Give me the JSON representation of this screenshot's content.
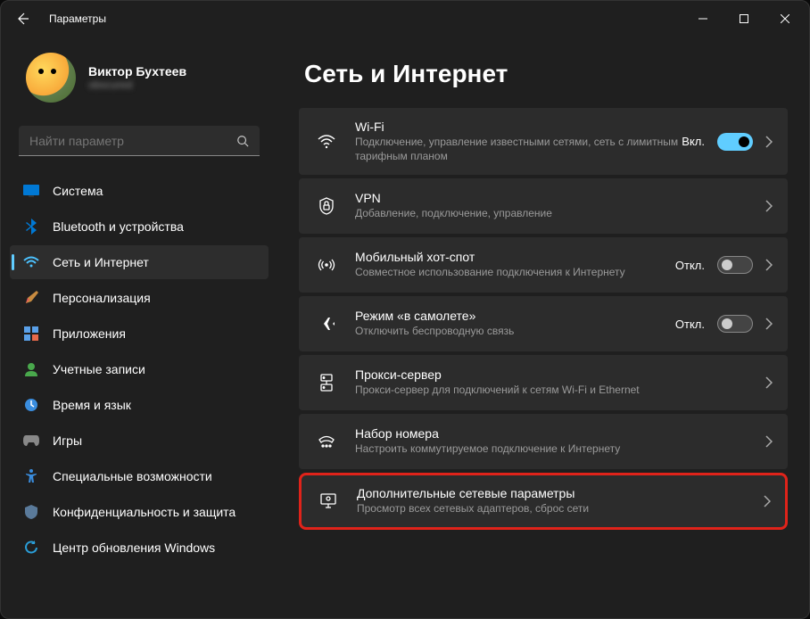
{
  "window": {
    "title": "Параметры"
  },
  "profile": {
    "name": "Виктор Бухтеев",
    "email": "obscured"
  },
  "search": {
    "placeholder": "Найти параметр"
  },
  "nav": [
    {
      "id": "system",
      "label": "Система"
    },
    {
      "id": "bluetooth",
      "label": "Bluetooth и устройства"
    },
    {
      "id": "network",
      "label": "Сеть и Интернет"
    },
    {
      "id": "personalization",
      "label": "Персонализация"
    },
    {
      "id": "apps",
      "label": "Приложения"
    },
    {
      "id": "accounts",
      "label": "Учетные записи"
    },
    {
      "id": "time",
      "label": "Время и язык"
    },
    {
      "id": "gaming",
      "label": "Игры"
    },
    {
      "id": "accessibility",
      "label": "Специальные возможности"
    },
    {
      "id": "privacy",
      "label": "Конфиденциальность и защита"
    },
    {
      "id": "update",
      "label": "Центр обновления Windows"
    }
  ],
  "page": {
    "title": "Сеть и Интернет"
  },
  "cards": {
    "wifi": {
      "title": "Wi-Fi",
      "sub": "Подключение, управление известными сетями, сеть с лимитным тарифным планом",
      "status": "Вкл."
    },
    "vpn": {
      "title": "VPN",
      "sub": "Добавление, подключение, управление"
    },
    "hotspot": {
      "title": "Мобильный хот-спот",
      "sub": "Совместное использование подключения к Интернету",
      "status": "Откл."
    },
    "airplane": {
      "title": "Режим «в самолете»",
      "sub": "Отключить беспроводную связь",
      "status": "Откл."
    },
    "proxy": {
      "title": "Прокси-сервер",
      "sub": "Прокси-сервер для подключений к сетям Wi-Fi и Ethernet"
    },
    "dialup": {
      "title": "Набор номера",
      "sub": "Настроить коммутируемое подключение к Интернету"
    },
    "advanced": {
      "title": "Дополнительные сетевые параметры",
      "sub": "Просмотр всех сетевых адаптеров, сброс сети"
    }
  }
}
